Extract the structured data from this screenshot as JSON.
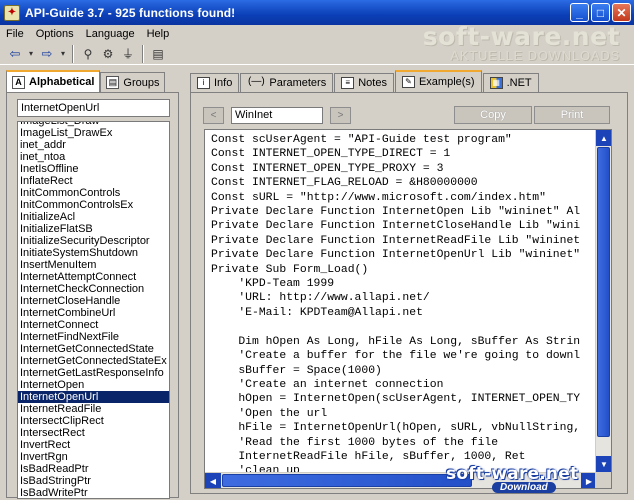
{
  "window": {
    "title": "API-Guide 3.7 - 925 functions found!",
    "controls": {
      "minimize": "_",
      "maximize": "□",
      "close": "✕"
    }
  },
  "menu": [
    "File",
    "Options",
    "Language",
    "Help"
  ],
  "toolbar": {
    "icons": [
      "back-arrow-icon",
      "dropdown-icon",
      "forward-arrow-icon",
      "dropdown-icon",
      "search-icon",
      "tools-icon",
      "plug-icon",
      "document-icon"
    ]
  },
  "watermark": {
    "main": "soft-ware.net",
    "sub": "AKTUELLE DOWNLOADS"
  },
  "left": {
    "tabs": [
      {
        "label": "Alphabetical",
        "icon": "A"
      },
      {
        "label": "Groups",
        "icon": "▤"
      }
    ],
    "search_value": "InternetOpenUrl",
    "functions": [
      "ImageList_Draw",
      "ImageList_DrawEx",
      "inet_addr",
      "inet_ntoa",
      "InetIsOffline",
      "InflateRect",
      "InitCommonControls",
      "InitCommonControlsEx",
      "InitializeAcl",
      "InitializeFlatSB",
      "InitializeSecurityDescriptor",
      "InitiateSystemShutdown",
      "InsertMenuItem",
      "InternetAttemptConnect",
      "InternetCheckConnection",
      "InternetCloseHandle",
      "InternetCombineUrl",
      "InternetConnect",
      "InternetFindNextFile",
      "InternetGetConnectedState",
      "InternetGetConnectedStateEx",
      "InternetGetLastResponseInfo",
      "InternetOpen",
      "InternetOpenUrl",
      "InternetReadFile",
      "IntersectClipRect",
      "IntersectRect",
      "InvertRect",
      "InvertRgn",
      "IsBadReadPtr",
      "IsBadStringPtr",
      "IsBadWritePtr"
    ],
    "selected_index": 23
  },
  "right": {
    "tabs": [
      {
        "label": "Info",
        "icon": "i"
      },
      {
        "label": "Parameters",
        "icon": "(—)"
      },
      {
        "label": "Notes",
        "icon": "≡"
      },
      {
        "label": "Example(s)",
        "icon": "✎"
      },
      {
        "label": ".NET",
        "icon": "▦"
      }
    ],
    "active_tab": 3,
    "prev_label": "<",
    "next_label": ">",
    "example_name": "WinInet",
    "copy_label": "Copy",
    "print_label": "Print",
    "code": "Const scUserAgent = \"API-Guide test program\"\nConst INTERNET_OPEN_TYPE_DIRECT = 1\nConst INTERNET_OPEN_TYPE_PROXY = 3\nConst INTERNET_FLAG_RELOAD = &H80000000\nConst sURL = \"http://www.microsoft.com/index.htm\"\nPrivate Declare Function InternetOpen Lib \"wininet\" Al\nPrivate Declare Function InternetCloseHandle Lib \"wini\nPrivate Declare Function InternetReadFile Lib \"wininet\nPrivate Declare Function InternetOpenUrl Lib \"wininet\"\nPrivate Sub Form_Load()\n    'KPD-Team 1999\n    'URL: http://www.allapi.net/\n    'E-Mail: KPDTeam@Allapi.net\n\n    Dim hOpen As Long, hFile As Long, sBuffer As Strin\n    'Create a buffer for the file we're going to downl\n    sBuffer = Space(1000)\n    'Create an internet connection\n    hOpen = InternetOpen(scUserAgent, INTERNET_OPEN_TY\n    'Open the url\n    hFile = InternetOpenUrl(hOpen, sURL, vbNullString,\n    'Read the first 1000 bytes of the file\n    InternetReadFile hFile, sBuffer, 1000, Ret\n    'clean up"
  },
  "watermark2": {
    "main": "soft-ware.net",
    "badge": "Download"
  }
}
